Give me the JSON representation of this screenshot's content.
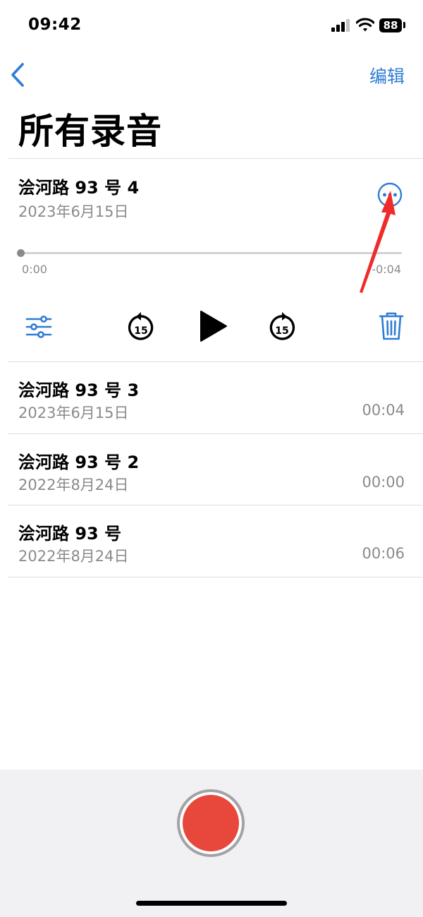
{
  "status_bar": {
    "time": "09:42",
    "battery": "88"
  },
  "nav": {
    "edit_label": "编辑"
  },
  "page_title": "所有录音",
  "expanded_recording": {
    "title": "浍河路 93 号 4",
    "date": "2023年6月15日",
    "elapsed": "0:00",
    "remaining": "-0:04",
    "progress": 0,
    "skip_seconds": "15"
  },
  "recordings": [
    {
      "title": "浍河路 93 号 3",
      "date": "2023年6月15日",
      "duration": "00:04"
    },
    {
      "title": "浍河路 93 号 2",
      "date": "2022年8月24日",
      "duration": "00:00"
    },
    {
      "title": "浍河路 93 号",
      "date": "2022年8月24日",
      "duration": "00:06"
    }
  ],
  "colors": {
    "accent": "#2f7bd6",
    "record": "#e8483b",
    "annotation_arrow": "#ef2b2b"
  }
}
